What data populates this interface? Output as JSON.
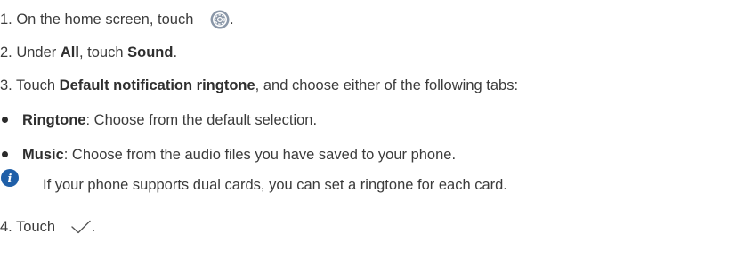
{
  "steps": {
    "s1": {
      "prefix": "1. On the home screen, touch",
      "icon": "settings-icon",
      "suffix": "."
    },
    "s2": {
      "prefix": "2. Under",
      "bold1": "All",
      "mid": ", touch",
      "bold2": "Sound",
      "suffix": "."
    },
    "s3": {
      "prefix": "3. Touch",
      "bold1": "Default notification ringtone",
      "suffix": ", and choose either of the following tabs:"
    },
    "bullets": [
      {
        "label": "Ringtone",
        "text": ": Choose from the default selection."
      },
      {
        "label": "Music",
        "text": ": Choose from the audio files you have saved to your phone."
      }
    ],
    "note": {
      "icon": "info-icon",
      "text": "If your phone supports dual cards, you can set a ringtone for each card."
    },
    "s4": {
      "prefix": "4. Touch",
      "icon": "checkmark-icon",
      "suffix": "."
    }
  },
  "colors": {
    "text": "#3b3b3b",
    "info_icon": "#1f5fa8",
    "settings_icon": "#8a97a8"
  }
}
